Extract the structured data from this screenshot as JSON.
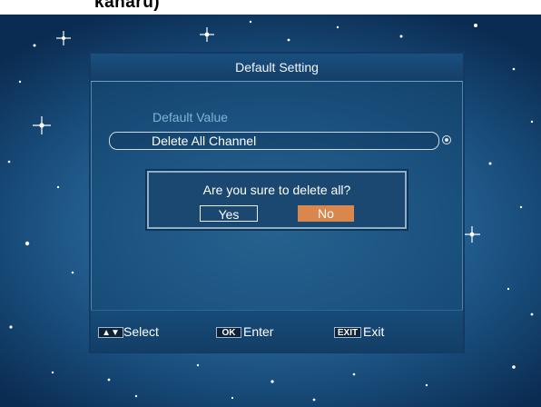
{
  "top_strip": {
    "text": "kanaru)"
  },
  "panel": {
    "title": "Default Setting",
    "section_label": "Default Value",
    "selected_item": "Delete All Channel"
  },
  "dialog": {
    "message": "Are you sure to delete all?",
    "yes_label": "Yes",
    "no_label": "No",
    "focused": "No"
  },
  "footer": {
    "select_key": "▲▼",
    "select_label": "Select",
    "ok_key": "OK",
    "ok_label": "Enter",
    "exit_key": "EXIT",
    "exit_label": "Exit"
  },
  "colors": {
    "focus_button": "#d9874d",
    "section_label": "#7fb4d9",
    "background": "#2a6a9e"
  }
}
